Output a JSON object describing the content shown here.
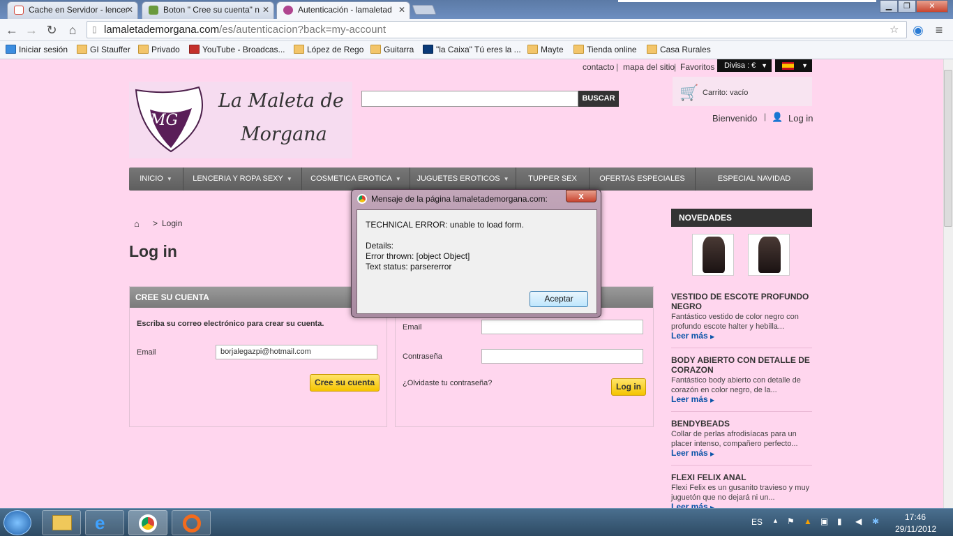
{
  "browser": {
    "tabs": [
      {
        "label": "Cache en Servidor - lencer",
        "color": "#d44638"
      },
      {
        "label": "Boton \" Cree su cuenta\" n",
        "color": "#6a9a3c"
      },
      {
        "label": "Autenticación - lamaletad",
        "color": "#b0458f"
      }
    ],
    "url_domain": "lamaletademorgana.com",
    "url_path": "/es/autenticacion?back=my-account",
    "bookmarks": [
      "Iniciar sesión",
      "GI Stauffer",
      "Privado",
      "YouTube - Broadcas...",
      "López de Rego",
      "Guitarra",
      "\"la Caixa\" Tú eres la ...",
      "Mayte",
      "Tienda online",
      "Casa Rurales"
    ]
  },
  "site": {
    "toplinks": [
      "contacto",
      "mapa del sitio",
      "Favoritos"
    ],
    "currency": "Divisa : €",
    "logo_line1": "La Maleta de",
    "logo_line2": "Morgana",
    "logo_mark": "MG",
    "search_button": "BUSCAR",
    "cart": "Carrito: vacío",
    "welcome": "Bienvenido",
    "login_link": "Log in",
    "menu": [
      "INICIO",
      "LENCERIA Y ROPA SEXY",
      "COSMETICA EROTICA",
      "JUGUETES EROTICOS",
      "TUPPER SEX",
      "OFERTAS ESPECIALES",
      "ESPECIAL NAVIDAD"
    ],
    "breadcrumb_sep": ">",
    "breadcrumb": "Login",
    "page_title": "Log in",
    "create": {
      "header": "CREE SU CUENTA",
      "intro": "Escriba su correo electrónico para crear su cuenta.",
      "email_label": "Email",
      "email_value": "borjalegazpi@hotmail.com",
      "button": "Cree su cuenta"
    },
    "login": {
      "email_label": "Email",
      "password_label": "Contraseña",
      "forgot": "¿Olvidaste tu contraseña?",
      "button": "Log in"
    },
    "sidebar": {
      "title": "NOVEDADES",
      "products": [
        {
          "title": "VESTIDO DE ESCOTE PROFUNDO NEGRO",
          "desc": "Fantástico vestido de color negro con profundo escote halter y hebilla...",
          "more": "Leer más"
        },
        {
          "title": "BODY ABIERTO CON DETALLE DE CORAZON",
          "desc": "Fantástico body abierto con detalle de corazón en color negro, de la...",
          "more": "Leer más"
        },
        {
          "title": "BENDYBEADS",
          "desc": "Collar de perlas afrodisíacas para un placer intenso, compañero perfecto...",
          "more": "Leer más"
        },
        {
          "title": "FLEXI FELIX ANAL",
          "desc": "Flexi Felix  es un gusanito travieso y muy juguetón que no dejará ni un...",
          "more": "Leer más"
        }
      ]
    }
  },
  "dialog": {
    "title": "Mensaje de la página lamaletademorgana.com:",
    "close": "x",
    "line1": "TECHNICAL ERROR: unable to load form.",
    "line2": "Details:",
    "line3": "Error thrown: [object Object]",
    "line4": "Text status: parsererror",
    "ok": "Aceptar"
  },
  "taskbar": {
    "lang": "ES",
    "time": "17:46",
    "date": "29/11/2012"
  }
}
